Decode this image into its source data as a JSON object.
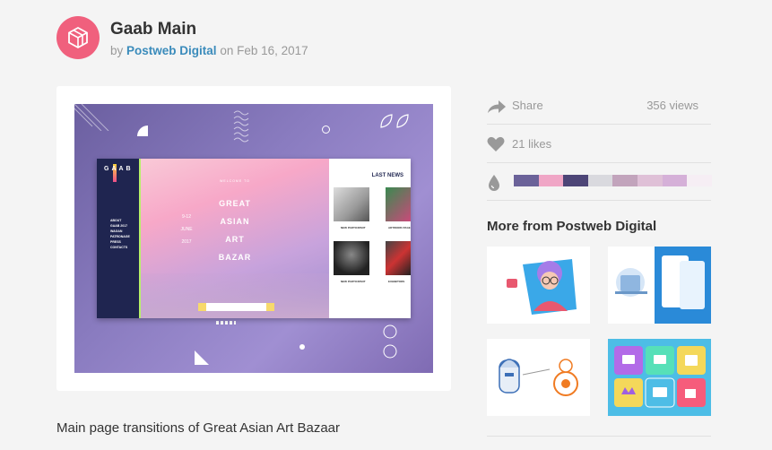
{
  "shot": {
    "title": "Gaab Main",
    "by_label": "by",
    "author": "Postweb Digital",
    "on_label": "on",
    "date": "Feb 16, 2017",
    "description": "Main page transitions of Great Asian Art Bazaar"
  },
  "preview": {
    "logo": "GAAB",
    "nav": [
      "ABOUT",
      "GAAB 2017",
      "WAGAN",
      "PATRONAGE",
      "PRESS",
      "CONTACTS"
    ],
    "welcome": "WELCOME TO",
    "hero_lines": [
      "GREAT",
      "ASIAN",
      "ART",
      "BAZAR"
    ],
    "date_lines": [
      "9-12",
      "JUNE",
      "2017"
    ],
    "news_title": "LAST NEWS",
    "news_captions": [
      "NEW PARTICIPANT",
      "ARTWORK PAGE",
      "NEW PARTICIPANT",
      "EXHIBITORS"
    ]
  },
  "stats": {
    "share_label": "Share",
    "views": "356 views",
    "likes": "21 likes"
  },
  "palette": [
    "#6b6299",
    "#f0a6c6",
    "#4d4577",
    "#d9d9de",
    "#c2a4bc",
    "#dfc0d7",
    "#d5b0d8",
    "#f6eef4"
  ],
  "icons": {
    "avatar": "cube-logo-icon",
    "share": "share-arrow-icon",
    "likes": "heart-icon",
    "colors": "drop-icon"
  },
  "more": {
    "title": "More from Postweb Digital",
    "thumbs": [
      "woman-illustration",
      "devices-illustration",
      "robots-illustration",
      "app-icons-grid"
    ]
  }
}
